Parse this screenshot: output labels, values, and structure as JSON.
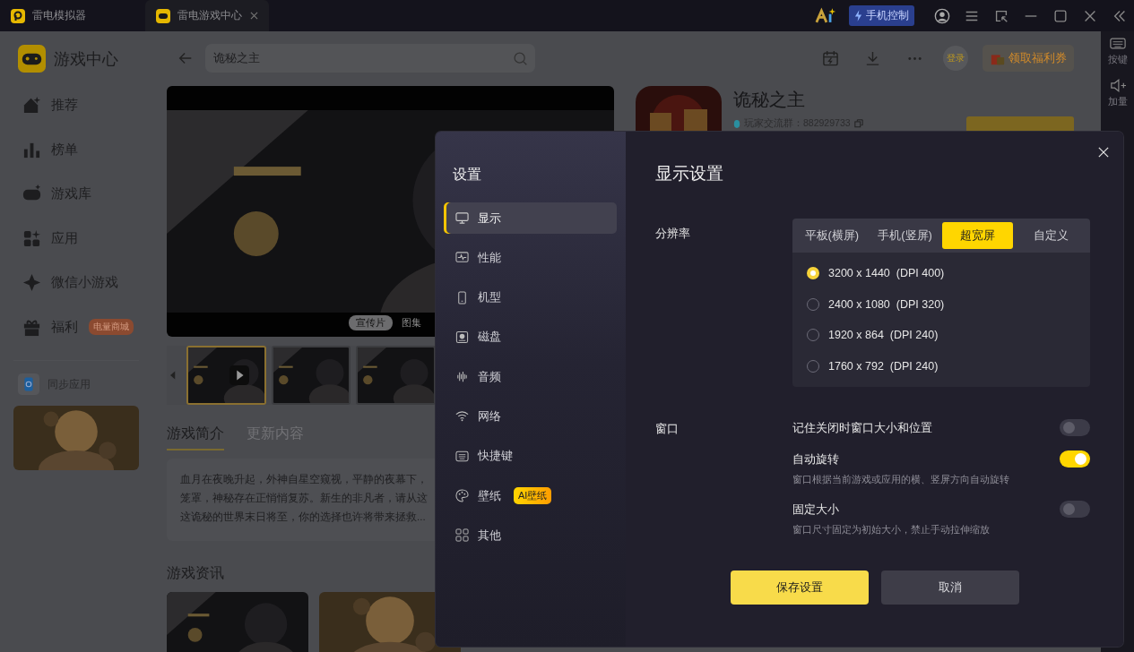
{
  "title_bar": {
    "tabs": [
      {
        "label": "雷电模拟器",
        "selected": false
      },
      {
        "label": "雷电游戏中心",
        "selected": true
      }
    ],
    "phone_control": "手机控制"
  },
  "right_rail": [
    {
      "label": "按键"
    },
    {
      "label": "加量"
    }
  ],
  "sidebar": {
    "title": "游戏中心",
    "items": [
      {
        "label": "推荐"
      },
      {
        "label": "榜单"
      },
      {
        "label": "游戏库"
      },
      {
        "label": "应用"
      },
      {
        "label": "微信小游戏"
      },
      {
        "label": "福利",
        "badge": "电量商城"
      }
    ],
    "sync": "同步应用",
    "promo": {
      "kind": "picture"
    }
  },
  "search": {
    "value": "诡秘之主"
  },
  "header_actions": {
    "login": "登录",
    "coupon": "领取福利券"
  },
  "media": {
    "tabs": [
      {
        "label": "宣传片",
        "selected": true
      },
      {
        "label": "图集",
        "selected": false
      }
    ],
    "thumbnails": [
      {
        "kind": "video",
        "selected": true
      },
      {
        "kind": "picture",
        "selected": false
      },
      {
        "kind": "picture",
        "selected": false
      }
    ]
  },
  "game": {
    "title": "诡秘之主",
    "group": "玩家交流群：882929733"
  },
  "detail_tabs": [
    {
      "label": "游戏简介",
      "selected": true
    },
    {
      "label": "更新内容",
      "selected": false
    }
  ],
  "description": [
    "血月在夜晚升起，外神自星空窥视，平静的夜幕下，",
    "笼罩，神秘存在正悄悄复苏。新生的非凡者，请从这",
    "这诡秘的世界末日将至，你的选择也许将带来拯救..."
  ],
  "news": {
    "title": "游戏资讯",
    "items": [
      {
        "kind": "picture"
      },
      {
        "kind": "picture"
      }
    ]
  },
  "settings": {
    "title": "设置",
    "nav": [
      {
        "label": "显示",
        "selected": true
      },
      {
        "label": "性能",
        "selected": false
      },
      {
        "label": "机型",
        "selected": false
      },
      {
        "label": "磁盘",
        "selected": false
      },
      {
        "label": "音频",
        "selected": false
      },
      {
        "label": "网络",
        "selected": false
      },
      {
        "label": "快捷键",
        "selected": false
      },
      {
        "label": "壁纸",
        "selected": false,
        "badge": "AI壁纸"
      },
      {
        "label": "其他",
        "selected": false
      }
    ],
    "display": {
      "title": "显示设置",
      "resolution": {
        "label": "分辨率",
        "modes": [
          {
            "label": "平板(横屏)",
            "selected": false
          },
          {
            "label": "手机(竖屏)",
            "selected": false
          },
          {
            "label": "超宽屏",
            "selected": true
          },
          {
            "label": "自定义",
            "selected": false
          }
        ],
        "options": [
          {
            "label": "3200 x 1440  (DPI 400)",
            "selected": true
          },
          {
            "label": "2400 x 1080  (DPI 320)",
            "selected": false
          },
          {
            "label": "1920 x 864  (DPI 240)",
            "selected": false
          },
          {
            "label": "1760 x 792  (DPI 240)",
            "selected": false
          }
        ]
      },
      "window": {
        "label": "窗口",
        "toggles": [
          {
            "label": "记住关闭时窗口大小和位置",
            "on": false
          },
          {
            "label": "自动旋转",
            "hint": "窗口根据当前游戏或应用的横、竖屏方向自动旋转",
            "on": true
          },
          {
            "label": "固定大小",
            "hint": "窗口尺寸固定为初始大小，禁止手动拉伸缩放",
            "on": false
          }
        ]
      }
    },
    "buttons": {
      "save": "保存设置",
      "cancel": "取消"
    }
  }
}
